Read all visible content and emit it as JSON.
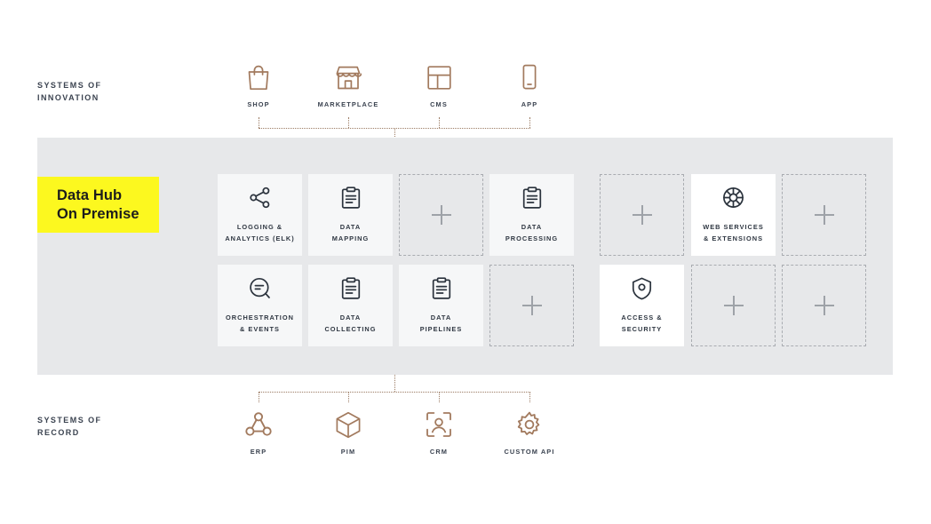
{
  "sections": {
    "innovation_label": "Systems of\ninnovation",
    "record_label": "Systems of\nrecord"
  },
  "hub": {
    "line1": "Data Hub",
    "line2": "On Premise",
    "highlight_color": "#fcf81f"
  },
  "colors": {
    "band": "#e7e8ea",
    "card_solid": "#f6f7f8",
    "card_white": "#ffffff",
    "card_dashed_border": "#a9acb1",
    "icon_dark": "#2b333d",
    "icon_brown": "#a27a5e",
    "connector": "#9b7b63",
    "text": "#3b4350"
  },
  "systems_of_innovation": [
    {
      "label": "Shop",
      "icon": "shopping-bag-icon"
    },
    {
      "label": "Marketplace",
      "icon": "storefront-icon"
    },
    {
      "label": "CMS",
      "icon": "layout-icon"
    },
    {
      "label": "App",
      "icon": "mobile-phone-icon"
    }
  ],
  "systems_of_record": [
    {
      "label": "ERP",
      "icon": "network-nodes-icon"
    },
    {
      "label": "PIM",
      "icon": "cube-box-icon"
    },
    {
      "label": "CRM",
      "icon": "person-frame-icon"
    },
    {
      "label": "Custom API",
      "icon": "gear-icon"
    }
  ],
  "grid": {
    "row1": [
      {
        "label": "Logging &\nAnalytics (ELK)",
        "icon": "share-nodes-icon",
        "style": "solid"
      },
      {
        "label": "Data\nMapping",
        "icon": "clipboard-icon",
        "style": "solid"
      },
      {
        "label": "",
        "icon": "plus-icon",
        "style": "dashed"
      },
      {
        "label": "Data\nProcessing",
        "icon": "clipboard-icon",
        "style": "solid"
      },
      {
        "label": "",
        "icon": "plus-icon",
        "style": "dashed"
      },
      {
        "label": "Web Services\n& Extensions",
        "icon": "globe-dial-icon",
        "style": "white"
      },
      {
        "label": "",
        "icon": "plus-icon",
        "style": "dashed"
      }
    ],
    "row2": [
      {
        "label": "Orchestration\n& Events",
        "icon": "chat-lines-icon",
        "style": "solid"
      },
      {
        "label": "Data\nCollecting",
        "icon": "clipboard-icon",
        "style": "solid"
      },
      {
        "label": "Data\nPipelines",
        "icon": "clipboard-icon",
        "style": "solid"
      },
      {
        "label": "",
        "icon": "plus-icon",
        "style": "dashed"
      },
      {
        "label": "Access &\nSecurity",
        "icon": "shield-icon",
        "style": "white"
      },
      {
        "label": "",
        "icon": "plus-icon",
        "style": "dashed"
      },
      {
        "label": "",
        "icon": "plus-icon",
        "style": "dashed"
      }
    ]
  }
}
